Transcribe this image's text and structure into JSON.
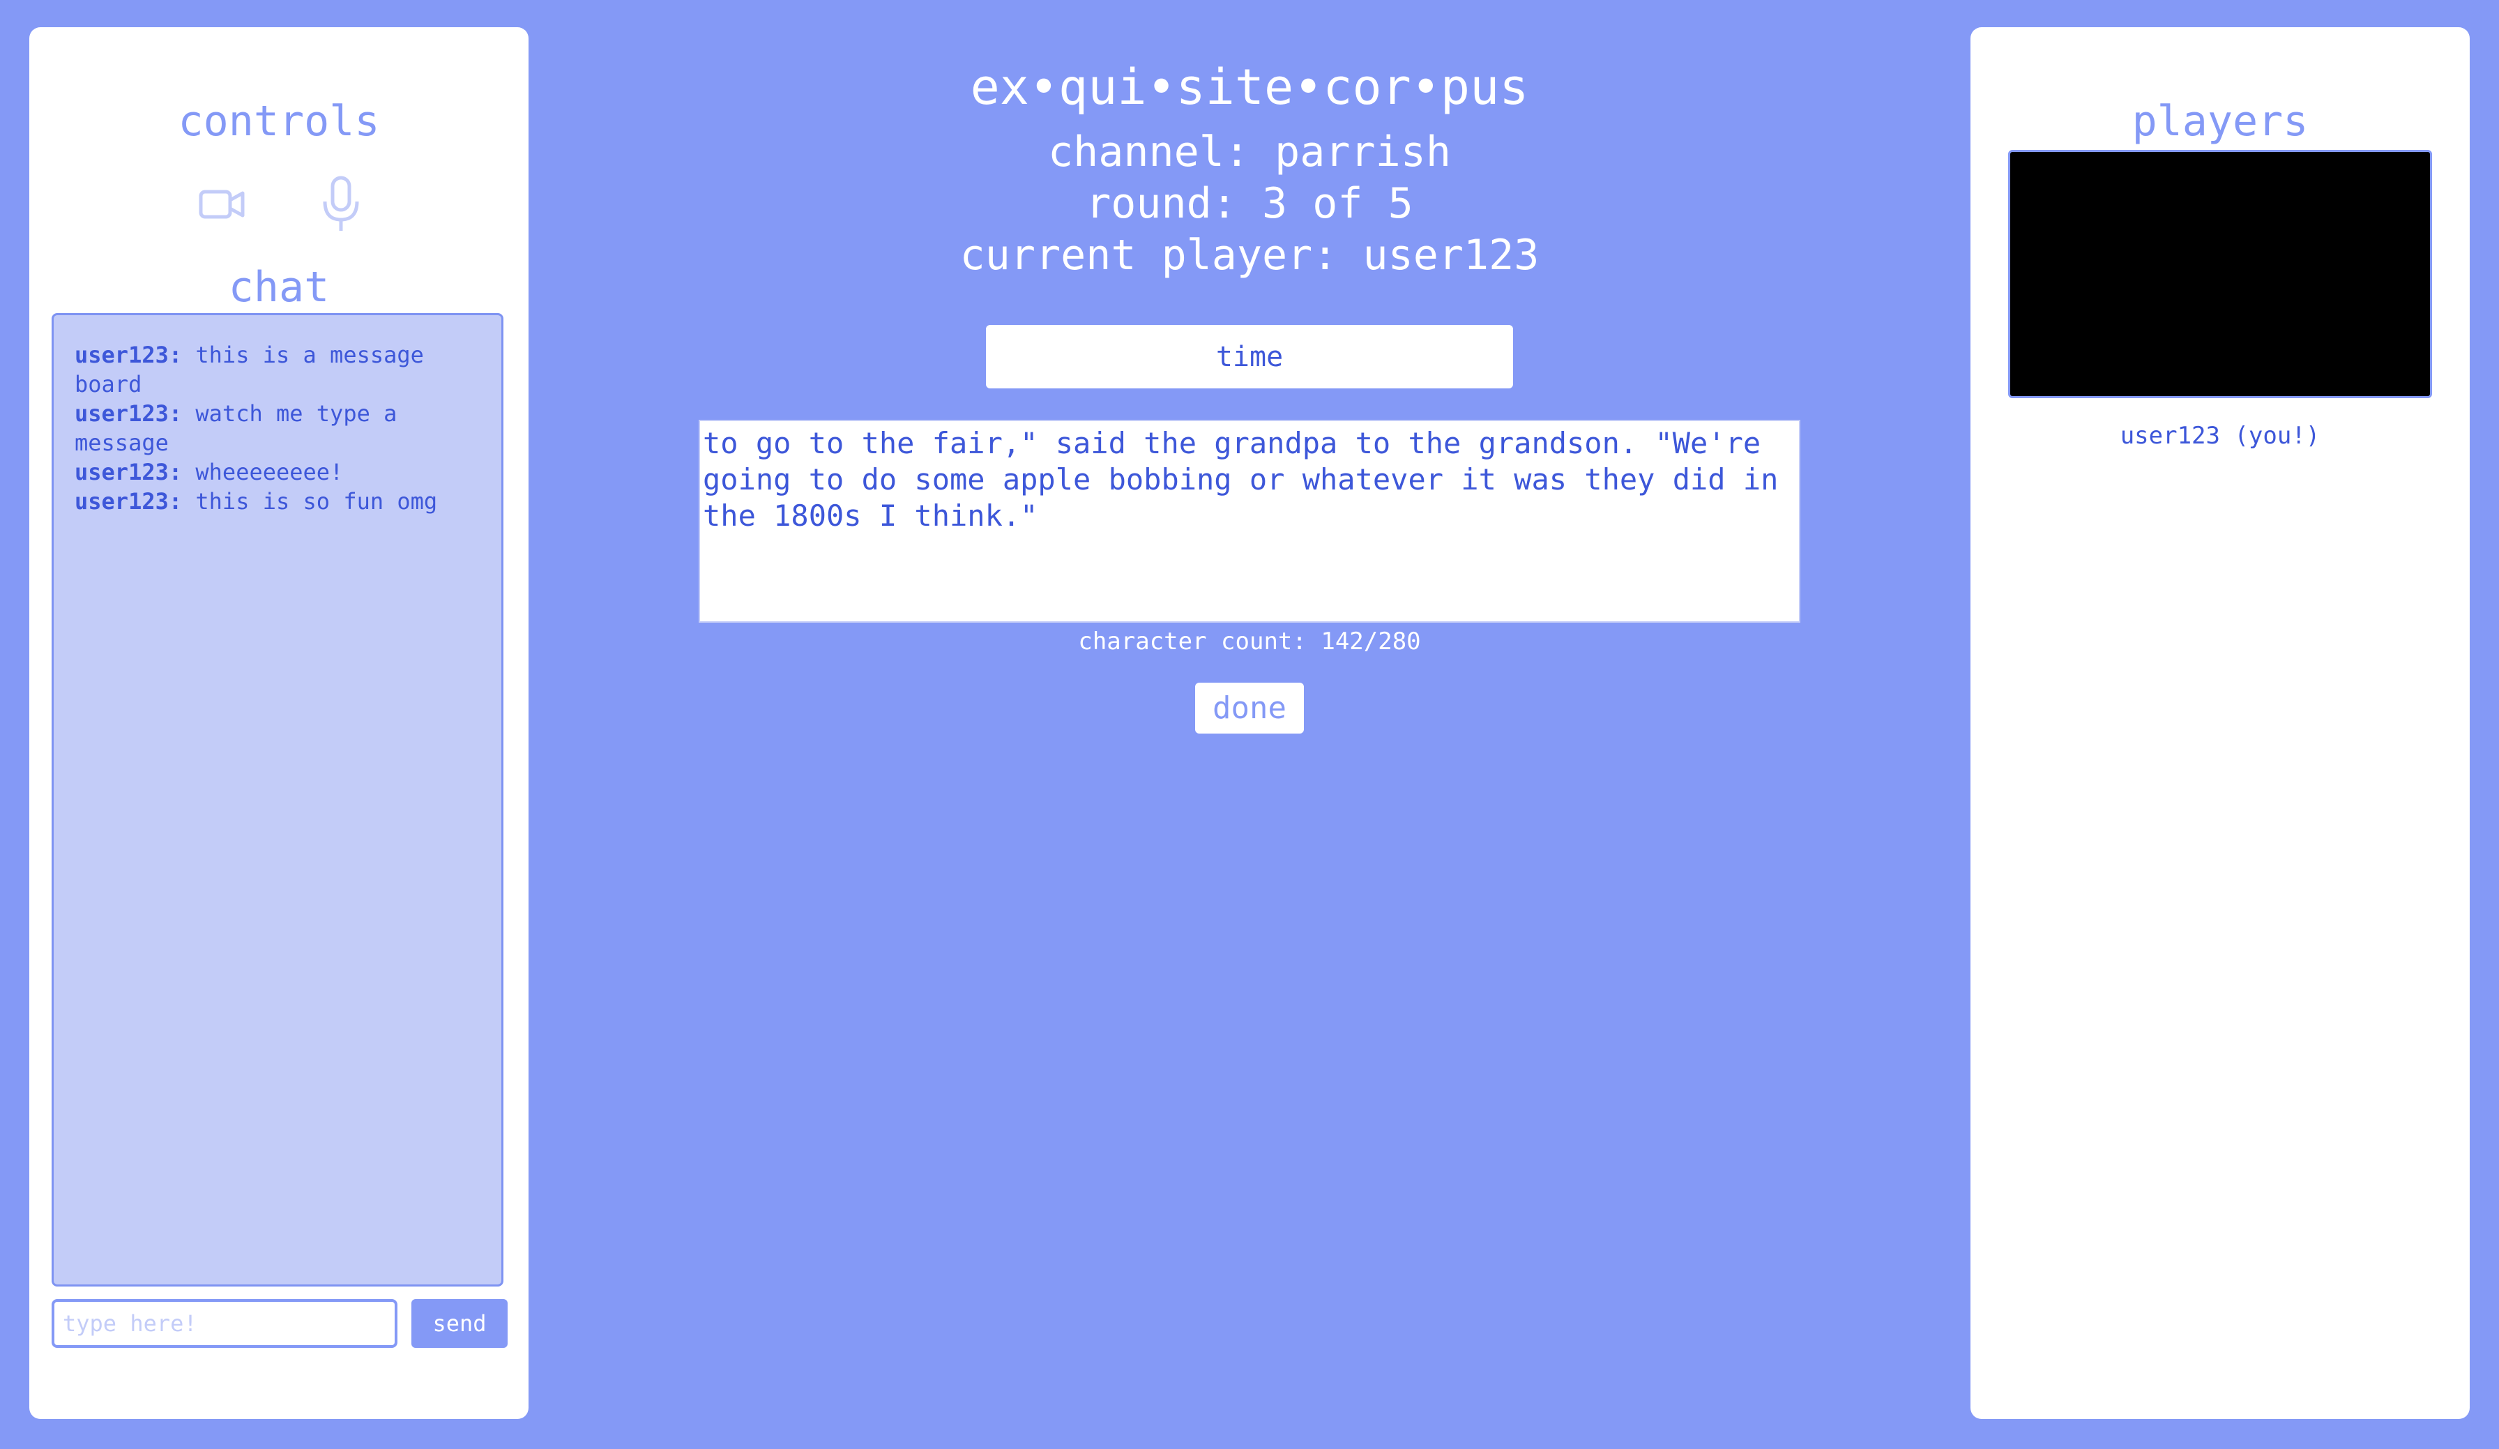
{
  "left_panel": {
    "controls_title": "controls",
    "video_icon": "video-camera-icon",
    "mic_icon": "microphone-icon",
    "chat_title": "chat",
    "messages": [
      {
        "user": "user123:",
        "text": " this is a message board"
      },
      {
        "user": "user123:",
        "text": " watch me type a message"
      },
      {
        "user": "user123:",
        "text": " wheeeeeeee!"
      },
      {
        "user": "user123:",
        "text": " this is so fun omg"
      }
    ],
    "chat_input_placeholder": "type here!",
    "send_label": "send"
  },
  "main": {
    "title": "ex•qui•site•cor•pus",
    "channel": "channel: parrish",
    "round": "round: 3 of 5",
    "current_player": "current player: user123",
    "time_label": "time",
    "story_text": "to go to the fair,\" said the grandpa to the grandson. \"We're going to do some apple bobbing or whatever it was they did in the 1800s I think.\"",
    "character_count": "character count: 142/280",
    "done_label": "done"
  },
  "right_panel": {
    "players_title": "players",
    "players": [
      {
        "name": "user123 (you!)"
      }
    ]
  },
  "colors": {
    "background": "#8499f6",
    "panel": "#ffffff",
    "accent_text": "#3d57d9",
    "chat_bg": "#c3ccf8"
  }
}
